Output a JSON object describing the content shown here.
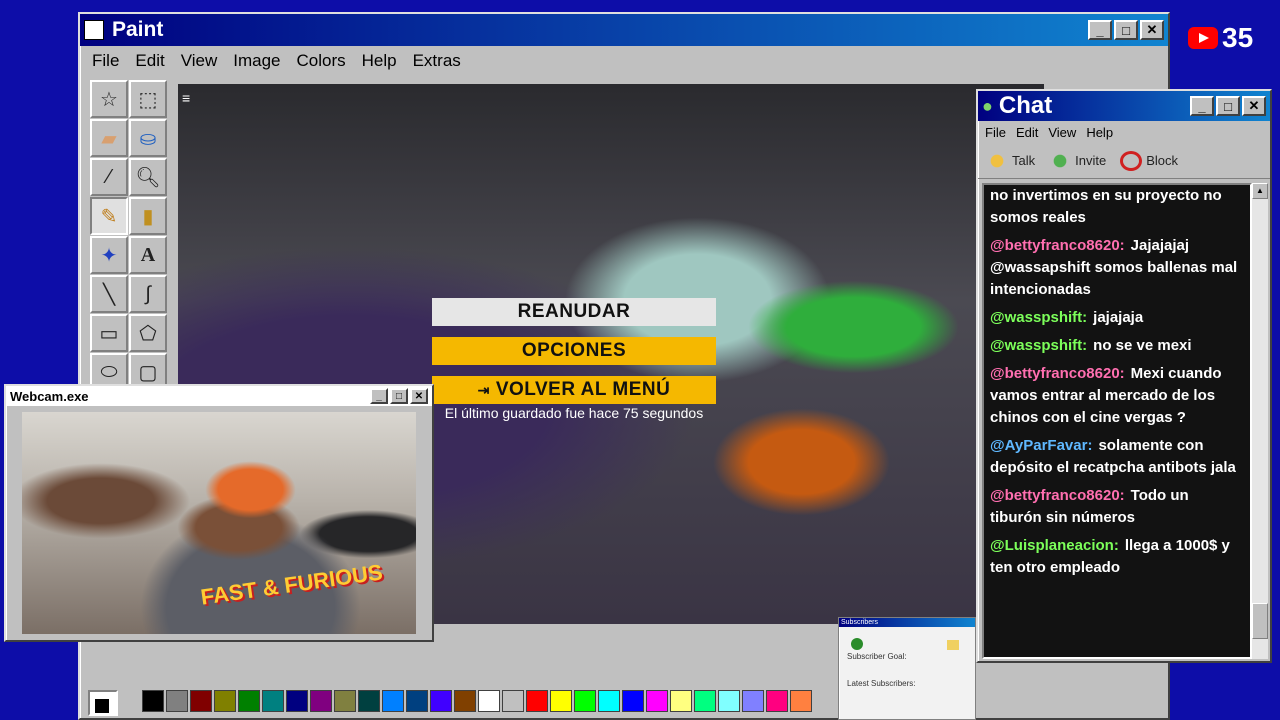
{
  "paint": {
    "title": "Paint",
    "menu": [
      "File",
      "Edit",
      "View",
      "Image",
      "Colors",
      "Help",
      "Extras"
    ],
    "tools": [
      "free-select",
      "rect-select",
      "eraser",
      "fill",
      "picker",
      "magnifier",
      "pencil",
      "brush",
      "airbrush",
      "text",
      "line",
      "curve",
      "rectangle",
      "polygon",
      "ellipse",
      "rounded-rect"
    ],
    "palette": [
      "#000000",
      "#808080",
      "#800000",
      "#808000",
      "#008000",
      "#008080",
      "#000080",
      "#800080",
      "#808040",
      "#004040",
      "#0080ff",
      "#004080",
      "#4000ff",
      "#804000",
      "#ffffff",
      "#c0c0c0",
      "#ff0000",
      "#ffff00",
      "#00ff00",
      "#00ffff",
      "#0000ff",
      "#ff00ff",
      "#ffff80",
      "#00ff80",
      "#80ffff",
      "#8080ff",
      "#ff0080",
      "#ff8040"
    ]
  },
  "game": {
    "resume": "REANUDAR",
    "options": "OPCIONES",
    "back": "VOLVER AL MENÚ",
    "saved": "El último guardado fue hace 75 segundos"
  },
  "youtube": {
    "count": "35"
  },
  "chat": {
    "title": "Chat",
    "menu": [
      "File",
      "Edit",
      "View",
      "Help"
    ],
    "talk": "Talk",
    "invite": "Invite",
    "block": "Block",
    "messages": [
      {
        "user": "",
        "text": "no invertimos en su proyecto no somos reales",
        "color": "#ffffff"
      },
      {
        "user": "@bettyfranco8620:",
        "text": "Jajajajaj @wassapshift somos ballenas mal intencionadas",
        "color": "#ff6fb0"
      },
      {
        "user": "@wasspshift:",
        "text": "jajajaja",
        "color": "#7cff5a"
      },
      {
        "user": "@wasspshift:",
        "text": "no se ve mexi",
        "color": "#7cff5a"
      },
      {
        "user": "@bettyfranco8620:",
        "text": "Mexi cuando vamos entrar al mercado de los chinos con el cine vergas ?",
        "color": "#ff6fb0"
      },
      {
        "user": "@AyParFavar:",
        "text": "solamente con depósito el recatpcha antibots jala",
        "color": "#5fb8ff"
      },
      {
        "user": "@bettyfranco8620:",
        "text": "Todo un tiburón sin números",
        "color": "#ff6fb0"
      },
      {
        "user": "@Luisplaneacion:",
        "text": "llega a 1000$ y ten otro empleado",
        "color": "#7cff5a"
      }
    ]
  },
  "webcam": {
    "title": "Webcam.exe",
    "shirt": "FAST & FURIOUS"
  },
  "subscribers": {
    "title": "Subscribers",
    "goal": "Subscriber Goal:",
    "latest": "Latest Subscribers:"
  }
}
